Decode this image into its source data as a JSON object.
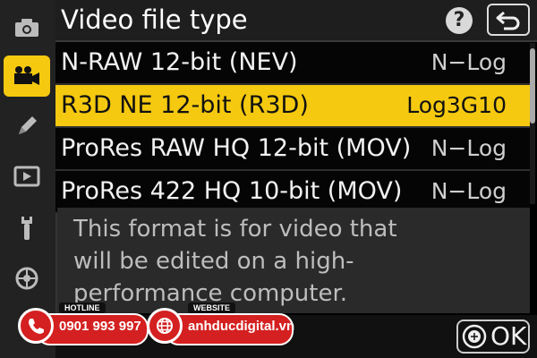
{
  "header": {
    "title": "Video file type",
    "help_label": "?"
  },
  "sidebar": {
    "items": [
      {
        "icon": "camera-icon"
      },
      {
        "icon": "video-camera-icon",
        "active": true
      },
      {
        "icon": "pencil-icon"
      },
      {
        "icon": "playback-icon"
      },
      {
        "icon": "wrench-icon"
      },
      {
        "icon": "network-icon"
      }
    ]
  },
  "list": {
    "items": [
      {
        "name": "N-RAW 12-bit (NEV)",
        "gamma": "N−Log"
      },
      {
        "name": "R3D NE 12-bit (R3D)",
        "gamma": "Log3G10",
        "selected": true
      },
      {
        "name": "ProRes RAW HQ 12-bit (MOV)",
        "gamma": "N−Log"
      },
      {
        "name": "ProRes 422 HQ 10-bit (MOV)",
        "gamma": "N−Log"
      }
    ]
  },
  "description": {
    "line1": "This format is for video that",
    "line2": "will be edited on a high-",
    "line3": "performance computer."
  },
  "footer": {
    "ok_label": "OK"
  },
  "watermark": {
    "hotline_tag": "HOTLINE",
    "hotline_value": "0901 993 997",
    "website_tag": "WEBSITE",
    "website_value": "anhducdigital.vn"
  },
  "colors": {
    "accent": "#f5c90f",
    "banner_red": "#d42020"
  }
}
